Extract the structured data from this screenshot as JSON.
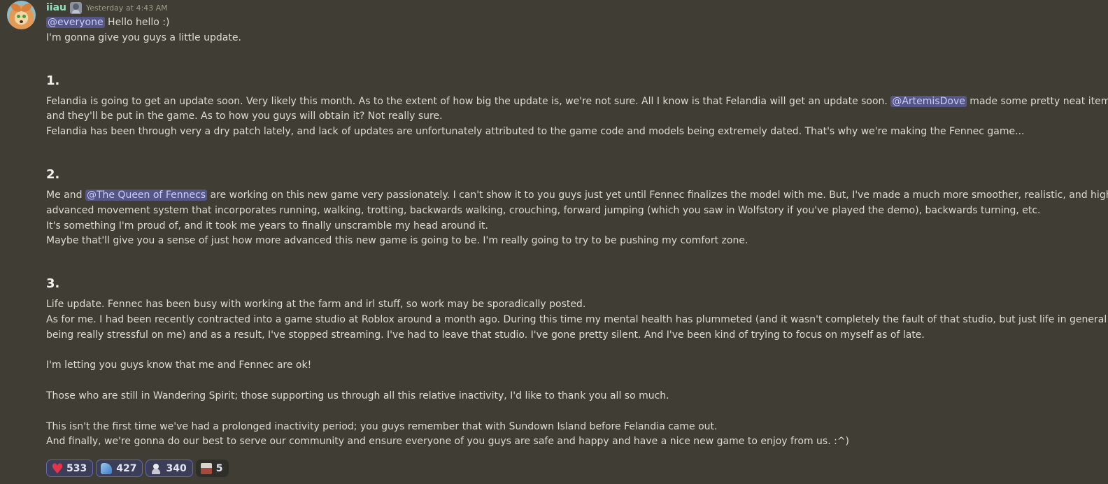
{
  "message": {
    "username": "iiau",
    "badge_icon": "gear-badge-icon",
    "timestamp": "Yesterday at 4:43 AM"
  },
  "mentions": {
    "everyone": "@everyone",
    "artemis": "@ArtemisDove",
    "queen": "@The Queen of Fennecs"
  },
  "body": {
    "greeting_after_mention": " Hello hello :)",
    "intro": "I'm gonna give you guys a little update.",
    "h1": "1.",
    "s1_p1_before": "Felandia is going to get an update soon. Very likely this month. As to the extent of how big the update is, we're not sure. All I know is that Felandia will get an update soon. ",
    "s1_p1_after": " made some pretty neat items",
    "s1_p1_line2": "and they'll be put in the game. As to how you guys will obtain it? Not really sure.",
    "s1_p2": "Felandia has been through very a dry patch lately, and lack of updates are unfortunately attributed to the game code and models being extremely dated. That's why we're making the Fennec game...",
    "h2": "2.",
    "s2_p1_before": "Me and ",
    "s2_p1_after": " are working on this new game very passionately. I can't show it to you guys just yet until Fennec finalizes the model with me. But, I've made a much more smoother, realistic, and highly",
    "s2_p1_line2": "advanced movement system that incorporates running, walking, trotting, backwards walking, crouching, forward jumping (which you saw in Wolfstory if you've played the demo), backwards turning, etc.",
    "s2_p2": "It's something I'm proud of, and it took me years to finally unscramble my head around it.",
    "s2_p3": "Maybe that'll give you a sense of just how more advanced this new game is going to be. I'm really going to try to be pushing my comfort zone.",
    "h3": "3.",
    "s3_p1": "Life update. Fennec has been busy with working at the farm and irl stuff, so work may be sporadically posted.",
    "s3_p2_line1": "As for me. I had been recently contracted into a game studio at Roblox around a month ago. During this time my mental health has plummeted (and it wasn't completely the fault of that studio, but just life in general",
    "s3_p2_line2": "being really stressful on me) and as a result, I've stopped streaming. I've had to leave that studio. I've gone pretty silent. And I've been kind of trying to focus on myself as of late.",
    "s3_p3": "I'm letting you guys know that me and Fennec are ok!",
    "s3_p4": "Those who are still in Wandering Spirit; those supporting us through all this relative inactivity, I'd like to thank you all so much.",
    "s3_p5": "This isn't the first time we've had a prolonged inactivity period; you guys remember that with Sundown Island before Felandia came out.",
    "s3_p6": "And finally, we're gonna do our best to serve our community and ensure everyone of you guys are safe and happy and have a nice new game to enjoy from us. :^)"
  },
  "reactions": [
    {
      "icon": "heart-icon",
      "count": "533"
    },
    {
      "icon": "wolf-emoji-icon",
      "count": "427"
    },
    {
      "icon": "figure-emoji-icon",
      "count": "340"
    },
    {
      "icon": "picture-emoji-icon",
      "count": "5"
    }
  ]
}
